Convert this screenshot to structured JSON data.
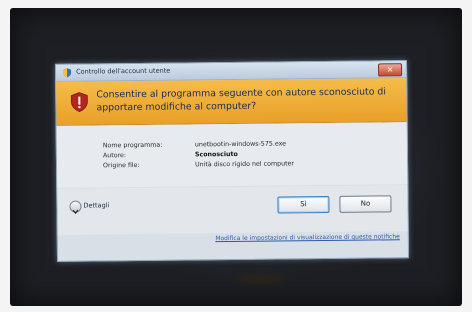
{
  "window": {
    "title": "Controllo dell'account utente",
    "close_label": "✕"
  },
  "banner": {
    "question": "Consentire al programma seguente con autore sconosciuto di apportare modifiche al computer?"
  },
  "details": {
    "rows": [
      {
        "label": "Nome programma:",
        "value": "unetbootin-windows-575.exe"
      },
      {
        "label": "Autore:",
        "value": "Sconosciuto"
      },
      {
        "label": "Origine file:",
        "value": "Unità disco rigido nel computer"
      }
    ]
  },
  "buttons": {
    "details_label": "Dettagli",
    "yes_label": "Sì",
    "no_label": "No"
  },
  "footer": {
    "link_text": "Modifica le impostazioni di visualizzazione di queste notifiche"
  },
  "colors": {
    "banner": "#f0b03a",
    "dialog_bg": "#e7ebf0",
    "link": "#2a5ca8"
  },
  "icons": {
    "title": "uac-shield-icon",
    "warning": "warning-shield-icon",
    "details": "chevron-down-icon"
  }
}
